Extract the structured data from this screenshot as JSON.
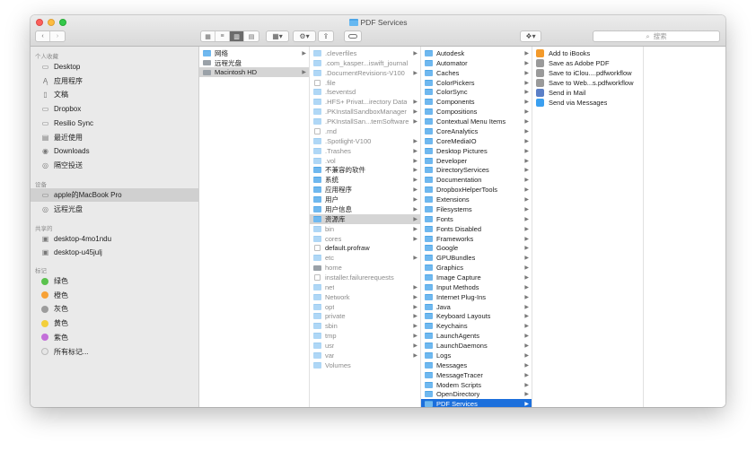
{
  "window": {
    "title": "PDF Services",
    "search_placeholder": "搜索",
    "toolbar": {
      "back_icon": "chevron-left-icon",
      "forward_icon": "chevron-right-icon",
      "view_icons": [
        "grid-view-icon",
        "list-view-icon",
        "column-view-icon",
        "gallery-view-icon"
      ],
      "arrange_icon": "arrange-icon",
      "action_icon": "gear-icon",
      "share_icon": "share-icon",
      "tag_icon": "tag-icon",
      "dropbox_icon": "dropbox-icon"
    }
  },
  "sidebar": {
    "favorites_header": "个人收藏",
    "favorites": [
      "Desktop",
      "应用程序",
      "文稿",
      "Dropbox",
      "Resilio Sync",
      "最近使用",
      "Downloads",
      "隔空投送"
    ],
    "devices_header": "设备",
    "devices": [
      "apple的MacBook Pro",
      "远程光盘"
    ],
    "shared_header": "共享的",
    "shared": [
      "desktop-4mo1ndu",
      "desktop-u45julj"
    ],
    "tags_header": "标记",
    "tags": [
      {
        "label": "绿色",
        "color": "#5ac24d"
      },
      {
        "label": "橙色",
        "color": "#f7a237"
      },
      {
        "label": "灰色",
        "color": "#9c9c9c"
      },
      {
        "label": "黄色",
        "color": "#f3cf3b"
      },
      {
        "label": "紫色",
        "color": "#c36fd9"
      },
      {
        "label": "所有标记...",
        "color": "#e6e6e6"
      }
    ]
  },
  "column1": [
    "网络",
    "远程光盘",
    "Macintosh HD"
  ],
  "column2": [
    ".cleverfiles",
    ".com_kasper...iswift_journal",
    ".DocumentRevisions-V100",
    ".file",
    ".fseventsd",
    ".HFS+ Privat...irectory Data",
    ".PKInstallSandboxManager",
    ".PKInstallSan...temSoftware",
    ".rnd",
    ".Spotlight-V100",
    ".Trashes",
    ".vol",
    "不兼容的软件",
    "系统",
    "应用程序",
    "用户",
    "用户信息",
    "资源库",
    "bin",
    "cores",
    "default.profraw",
    "etc",
    "home",
    "installer.failurerequests",
    "net",
    "Network",
    "opt",
    "private",
    "sbin",
    "tmp",
    "usr",
    "var",
    "Volumes"
  ],
  "column3": [
    "Autodesk",
    "Automator",
    "Caches",
    "ColorPickers",
    "ColorSync",
    "Components",
    "Compositions",
    "Contextual Menu Items",
    "CoreAnalytics",
    "CoreMediaIO",
    "Desktop Pictures",
    "Developer",
    "DirectoryServices",
    "Documentation",
    "DropboxHelperTools",
    "Extensions",
    "Filesystems",
    "Fonts",
    "Fonts Disabled",
    "Frameworks",
    "Google",
    "GPUBundles",
    "Graphics",
    "Image Capture",
    "Input Methods",
    "Internet Plug-Ins",
    "Java",
    "Keyboard Layouts",
    "Keychains",
    "LaunchAgents",
    "LaunchDaemons",
    "Logs",
    "Messages",
    "MessageTracer",
    "Modem Scripts",
    "OpenDirectory",
    "PDF Services"
  ],
  "column4": [
    "Add to iBooks",
    "Save as Adobe PDF",
    "Save to iClou....pdfworkflow",
    "Save to Web...s.pdfworkflow",
    "Send in Mail",
    "Send via Messages"
  ]
}
